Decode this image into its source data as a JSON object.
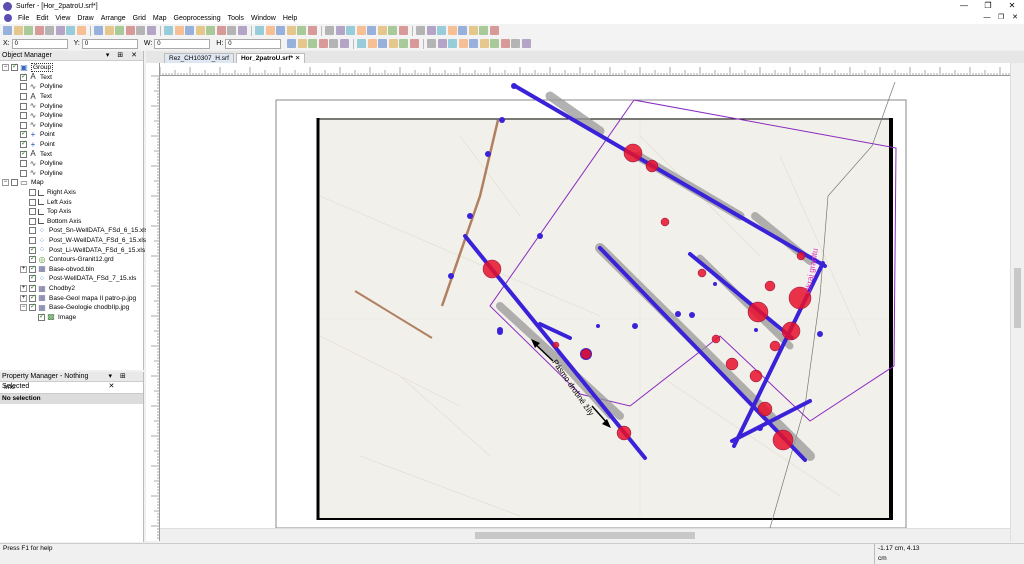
{
  "app": {
    "title": "Surfer - [Hor_2patroU.srf*]"
  },
  "menu": [
    "File",
    "Edit",
    "View",
    "Draw",
    "Arrange",
    "Grid",
    "Map",
    "Geoprocessing",
    "Tools",
    "Window",
    "Help"
  ],
  "position_fields": [
    {
      "label": "X:",
      "value": "0"
    },
    {
      "label": "Y:",
      "value": "0"
    },
    {
      "label": "W:",
      "value": "0"
    },
    {
      "label": "H:",
      "value": "0"
    }
  ],
  "object_manager": {
    "title": "Object Manager",
    "items": [
      {
        "label": "Group",
        "checked": true,
        "icon": "group-icon",
        "indent": 1,
        "expander": "−"
      },
      {
        "label": "Text",
        "checked": true,
        "icon": "text-icon",
        "indent": 2
      },
      {
        "label": "Polyline",
        "checked": false,
        "icon": "polyline-icon",
        "indent": 2
      },
      {
        "label": "Text",
        "checked": false,
        "icon": "text-icon",
        "indent": 2
      },
      {
        "label": "Polyline",
        "checked": false,
        "icon": "polyline-icon",
        "indent": 2
      },
      {
        "label": "Polyline",
        "checked": false,
        "icon": "polyline-icon",
        "indent": 2
      },
      {
        "label": "Polyline",
        "checked": false,
        "icon": "polyline-icon",
        "indent": 2
      },
      {
        "label": "Point",
        "checked": true,
        "icon": "point-icon",
        "indent": 2
      },
      {
        "label": "Point",
        "checked": true,
        "icon": "point-icon",
        "indent": 2
      },
      {
        "label": "Text",
        "checked": true,
        "icon": "text-icon",
        "indent": 2
      },
      {
        "label": "Polyline",
        "checked": false,
        "icon": "polyline-icon",
        "indent": 2
      },
      {
        "label": "Polyline",
        "checked": false,
        "icon": "polyline-icon",
        "indent": 2
      },
      {
        "label": "Map",
        "checked": false,
        "icon": "map-icon",
        "indent": 1,
        "expander": "−"
      },
      {
        "label": "Right Axis",
        "checked": false,
        "icon": "axis-icon",
        "indent": 3
      },
      {
        "label": "Left Axis",
        "checked": false,
        "icon": "axis-icon",
        "indent": 3
      },
      {
        "label": "Top Axis",
        "checked": false,
        "icon": "axis-icon",
        "indent": 3
      },
      {
        "label": "Bottom Axis",
        "checked": false,
        "icon": "axis-icon",
        "indent": 3
      },
      {
        "label": "Post_Sn-WellDATA_FSd_6_15.xls",
        "checked": false,
        "icon": "post-layer-icon",
        "indent": 3
      },
      {
        "label": "Post_W-WellDATA_FSd_6_15.xls",
        "checked": false,
        "icon": "post-layer-icon",
        "indent": 3
      },
      {
        "label": "Post_Li-WellDATA_FSd_6_15.xls",
        "checked": true,
        "icon": "post-layer-icon",
        "indent": 3
      },
      {
        "label": "Contours-Granit12.grd",
        "checked": true,
        "icon": "contour-layer-icon",
        "indent": 3
      },
      {
        "label": "Base-obvod.bln",
        "checked": true,
        "icon": "base-layer-icon",
        "indent": 3,
        "expander": "+"
      },
      {
        "label": "Post-WellDATA_FSd_7_15.xls",
        "checked": true,
        "icon": "post-layer-icon",
        "indent": 3
      },
      {
        "label": "Chodby2",
        "checked": true,
        "icon": "base-layer-icon",
        "indent": 3,
        "expander": "+"
      },
      {
        "label": "Base-Geol mapa II patro-p.jpg",
        "checked": true,
        "icon": "base-layer-icon",
        "indent": 3,
        "expander": "+"
      },
      {
        "label": "Base-Geologie chodbIIp.jpg",
        "checked": true,
        "icon": "base-layer-icon",
        "indent": 3,
        "expander": "−"
      },
      {
        "label": "Image",
        "checked": true,
        "icon": "image-icon",
        "indent": 4
      }
    ]
  },
  "property_manager": {
    "title": "Property Manager - Nothing Selected",
    "tab": "Info",
    "selection": "No selection"
  },
  "document_tabs": [
    {
      "label": "Rez_CH10307_H.srf",
      "active": false
    },
    {
      "label": "Hor_2patroU.srf*",
      "active": true
    }
  ],
  "map_labels": {
    "fault_label": "Pásmo drobné žíly",
    "granite_label": "Okraj granitu"
  },
  "colors": {
    "blue_series": "#3a22d8",
    "red_marker": "#e8102a",
    "purple_outline": "#8a2bbf",
    "pink_label": "#d531b8",
    "brown_line": "#b08060"
  },
  "status": {
    "help": "Press F1 for help",
    "coordinates": "-1.17 cm, 4.13 cm"
  }
}
